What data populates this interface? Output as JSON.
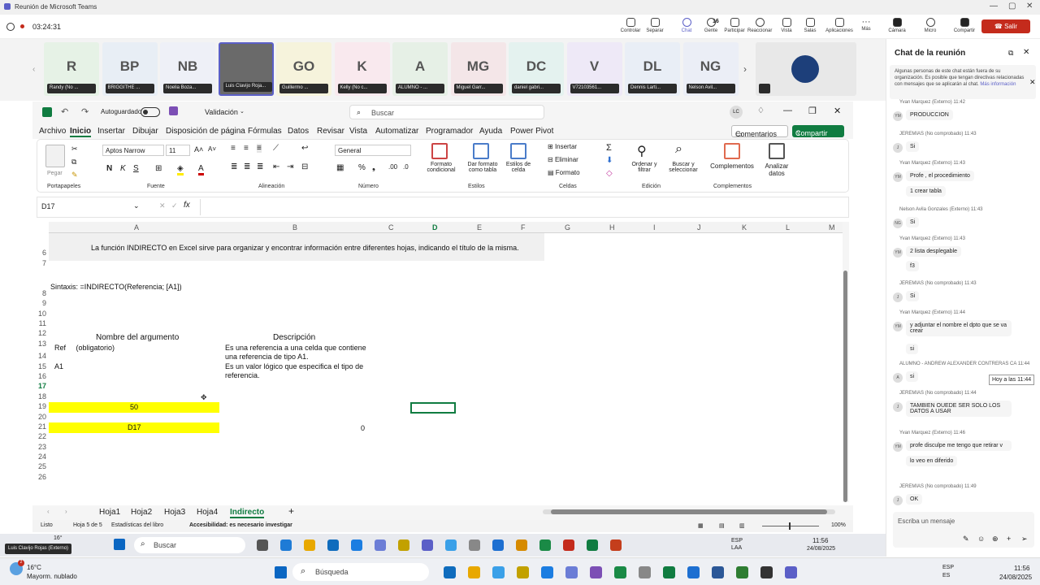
{
  "teams": {
    "window_title": "Reunión de Microsoft Teams",
    "timer": "03:24:31",
    "buttons": [
      "Controlar",
      "Separar",
      "Chat",
      "Gente",
      "Participar",
      "Reaccionar",
      "Vista",
      "Salas",
      "Aplicaciones",
      "Más",
      "Cámara",
      "Micro",
      "Compartir"
    ],
    "people_count": "16",
    "leave_label": "Salir",
    "participants": [
      {
        "initials": "R",
        "name": "Randy (No ...",
        "color": "#e6f2e6"
      },
      {
        "initials": "BP",
        "name": "BRIGGITHE ...",
        "color": "#e8eef5"
      },
      {
        "initials": "NB",
        "name": "Noelia Boza...",
        "color": "#eef0f7"
      },
      {
        "initials": "",
        "name": "Luis Clavijo Roja...",
        "color": "#6a6a6a"
      },
      {
        "initials": "GO",
        "name": "Guillermo ...",
        "color": "#f6f3dc"
      },
      {
        "initials": "K",
        "name": "Kelly (No c...",
        "color": "#f9e9ee"
      },
      {
        "initials": "A",
        "name": "ALUMNO - ...",
        "color": "#e6f0e6"
      },
      {
        "initials": "MG",
        "name": "Miguel Garr...",
        "color": "#f4e6e8"
      },
      {
        "initials": "DC",
        "name": "daniel gabri...",
        "color": "#e4f2ef"
      },
      {
        "initials": "V",
        "name": "V72103561...",
        "color": "#eee9f7"
      },
      {
        "initials": "DL",
        "name": "Dennis Larti...",
        "color": "#e9eef6"
      },
      {
        "initials": "NG",
        "name": "Nelson Avil...",
        "color": "#ebeef6"
      }
    ],
    "presenter_label": "Luis Clavijo Rojas (Externo)"
  },
  "excel": {
    "autosave_label": "Autoguardado",
    "doc_name": "Validación",
    "search_placeholder": "Buscar",
    "user_initials": "LC",
    "menu": [
      "Archivo",
      "Inicio",
      "Insertar",
      "Dibujar",
      "Disposición de página",
      "Fórmulas",
      "Datos",
      "Revisar",
      "Vista",
      "Automatizar",
      "Programador",
      "Ayuda",
      "Power Pivot"
    ],
    "comments_label": "Comentarios",
    "share_label": "Compartir",
    "ribbon": {
      "paste": "Pegar",
      "font_name": "Aptos Narrow",
      "font_size": "11",
      "number_format": "General",
      "insert": "Insertar",
      "delete": "Eliminar",
      "format": "Formato",
      "cond_format": "Formato condicional",
      "table_format": "Dar formato como tabla",
      "cell_styles": "Estilos de celda",
      "sort": "Ordenar y filtrar",
      "find": "Buscar y seleccionar",
      "addins": "Complementos",
      "analyze": "Analizar datos",
      "groups": [
        "Portapapeles",
        "Fuente",
        "Alineación",
        "Número",
        "Estilos",
        "Celdas",
        "Edición",
        "Complementos"
      ]
    },
    "name_box": "D17",
    "columns": [
      "A",
      "B",
      "C",
      "D",
      "E",
      "F",
      "G",
      "H",
      "I",
      "J",
      "K",
      "L",
      "M"
    ],
    "rows": [
      "6",
      "7",
      "8",
      "9",
      "10",
      "11",
      "12",
      "13",
      "14",
      "15",
      "16",
      "17",
      "18",
      "19",
      "20",
      "21",
      "22",
      "23",
      "24",
      "25",
      "26"
    ],
    "cells": {
      "intro": "La función INDIRECTO en Excel sirve para organizar y encontrar información entre diferentes hojas, indicando el título de la misma.",
      "syntax": "Sintaxis: =INDIRECTO(Referencia; [A1])",
      "arg_header": "Nombre del argumento",
      "desc_header": "Descripción",
      "ref": "Ref     (obligatorio)",
      "ref_desc1": "Es una referencia a una celda que contiene",
      "ref_desc2": "una referencia de tipo A1.",
      "a1": "A1",
      "a1_desc1": "Es un valor lógico que especifica el tipo de",
      "a1_desc2": "referencia.",
      "a17": "50",
      "a19": "D17",
      "b19": "0"
    },
    "sheets": [
      "Hoja1",
      "Hoja2",
      "Hoja3",
      "Hoja4",
      "Indirecto"
    ],
    "status": {
      "ready": "Listo",
      "sheet": "Hoja 5 de 5",
      "stats": "Estadísticas del libro",
      "accessibility": "Accesibilidad: es necesario investigar",
      "zoom": "100%"
    }
  },
  "inner_taskbar": {
    "temp": "16°",
    "search": "Buscar",
    "lang": "ESP\nLAA",
    "time": "11:56",
    "date": "24/08/2025"
  },
  "outer_taskbar": {
    "temp": "16°C",
    "weather": "Mayorm. nublado",
    "search": "Búsqueda",
    "lang": "ESP\nES",
    "time": "11:56",
    "date": "24/08/2025"
  },
  "chat": {
    "title": "Chat de la reunión",
    "notice": "Algunas personas de este chat están fuera de su organización. Es posible que tengan directivas relacionadas con mensajes que se aplicarán al chat.",
    "notice_link": "Más información",
    "tooltip": "Hoy a las 11:44",
    "input_placeholder": "Escriba un mensaje",
    "messages": [
      {
        "author": "Yvan Marquez (Externo)  11:42",
        "text": "PRODUCCION",
        "av": "YM"
      },
      {
        "author": "JEREMIAS (No comprobado)  11:43",
        "text": "Si",
        "av": "J"
      },
      {
        "author": "Yvan Marquez (Externo)  11:43",
        "text": "Profe , el procedimiento",
        "av": "YM"
      },
      {
        "author": "",
        "text": "1 crear tabla",
        "av": ""
      },
      {
        "author": "Nelson Avila Gonzales (Externo)  11:43",
        "text": "Si",
        "av": "NG"
      },
      {
        "author": "Yvan Marquez (Externo)  11:43",
        "text": "2 lista desplegable",
        "av": "YM"
      },
      {
        "author": "",
        "text": "f3",
        "av": ""
      },
      {
        "author": "JEREMIAS (No comprobado)  11:43",
        "text": "Si",
        "av": "J"
      },
      {
        "author": "Yvan Marquez (Externo)  11:44",
        "text": "y adjuntar el nombre el dpto que se va crear",
        "av": "YM"
      },
      {
        "author": "",
        "text": "si",
        "av": ""
      },
      {
        "author": "ALUMNO - ANDREW ALEXANDER CONTRERAS CA  11:44",
        "text": "si",
        "av": "A"
      },
      {
        "author": "JEREMIAS (No comprobado)  11:44",
        "text": "TAMBIEN OUEDE SER SOLO LOS DATOS A USAR",
        "av": "J"
      },
      {
        "author": "Yvan Marquez (Externo)  11:46",
        "text": "profe disculpe me tengo que retirar v",
        "av": "YM"
      },
      {
        "author": "",
        "text": "lo veo en diferido",
        "av": ""
      },
      {
        "author": "JEREMIAS (No comprobado)  11:49",
        "text": "OK",
        "av": "J"
      }
    ]
  }
}
